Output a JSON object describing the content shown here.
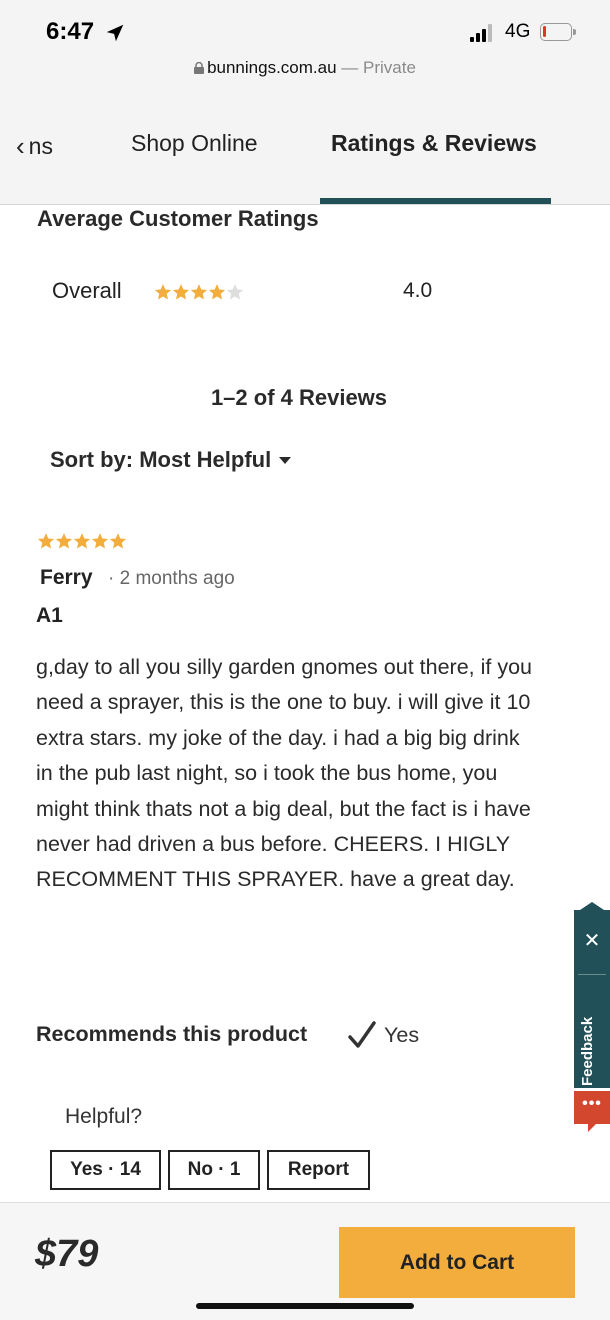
{
  "status": {
    "time": "6:47",
    "network": "4G",
    "battery_level": 0.12
  },
  "url_bar": {
    "domain": "bunnings.com.au",
    "mode": "— Private"
  },
  "tabs": [
    {
      "label": "ns"
    },
    {
      "label": "Shop Online"
    },
    {
      "label": "Ratings & Reviews",
      "active": true
    }
  ],
  "ratings": {
    "heading": "Average Customer Ratings",
    "overall_label": "Overall",
    "overall_value": "4.0",
    "overall_stars": 4
  },
  "reviews_count": "1–2 of 4 Reviews",
  "sort": {
    "label": "Sort by: Most Helpful"
  },
  "review": {
    "stars": 5,
    "author": "Ferry",
    "time_ago": "· 2 months ago",
    "title": "A1",
    "body": "g,day to all you silly garden gnomes out there, if you need a sprayer, this is the one to buy. i will give it 10 extra stars. my joke of the day. i had a big big drink in the pub last night, so i took the bus home, you might think thats not a big deal, but the fact is i have never had driven a bus before. CHEERS. I HIGLY RECOMMENT THIS SPRAYER. have a great day.",
    "recommends_label": "Recommends this product",
    "recommends_value": "Yes",
    "helpful_prompt": "Helpful?",
    "yes_button": "Yes · 14",
    "no_button": "No · 1",
    "report_button": "Report"
  },
  "feedback": {
    "label": "Feedback",
    "close": "✕",
    "chat": "•••"
  },
  "footer": {
    "price": "$79",
    "add_to_cart": "Add to Cart"
  },
  "colors": {
    "star": "#f2ad3d",
    "star_empty": "#dddddd",
    "accent": "#215058",
    "cart": "#f2ad3d",
    "chat": "#d3472f"
  }
}
